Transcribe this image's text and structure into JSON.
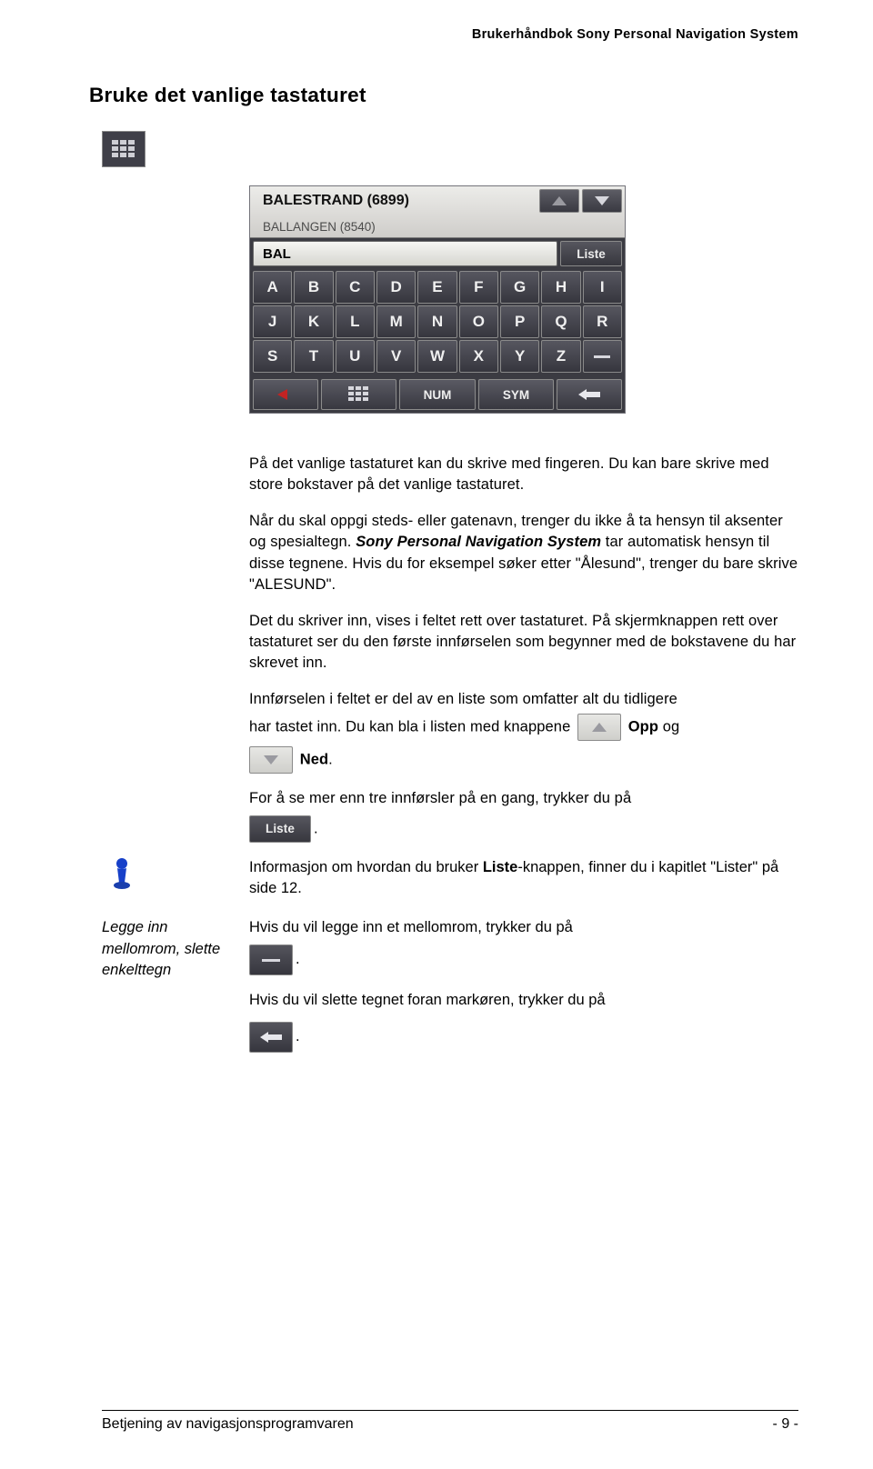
{
  "running_header": "Brukerhåndbok Sony Personal Navigation System",
  "section_title": "Bruke det vanlige tastaturet",
  "screenshot": {
    "suggestion_primary": "BALESTRAND (6899)",
    "suggestion_secondary": "BALLANGEN (8540)",
    "input_value": "BAL",
    "liste_label": "Liste",
    "row1": [
      "A",
      "B",
      "C",
      "D",
      "E",
      "F",
      "G",
      "H",
      "I"
    ],
    "row2": [
      "J",
      "K",
      "L",
      "M",
      "N",
      "O",
      "P",
      "Q",
      "R"
    ],
    "row3": [
      "S",
      "T",
      "U",
      "V",
      "W",
      "X",
      "Y",
      "Z",
      "_"
    ],
    "num_label": "NUM",
    "sym_label": "SYM"
  },
  "para1_a": "På det vanlige tastaturet kan du skrive med fingeren. Du kan bare skrive med store bokstaver på det vanlige tastaturet.",
  "para2_plain1": "Når du skal oppgi steds- eller gatenavn, trenger du ikke å ta hensyn til aksenter og spesialtegn. ",
  "para2_bi": "Sony Personal Navigation System",
  "para2_plain2": " tar automatisk hensyn til disse tegnene. Hvis du for eksempel søker etter \"Ålesund\", trenger du bare skrive \"ALESUND\".",
  "para3": "Det du skriver inn, vises i feltet rett over tastaturet. På skjermknappen rett over tastaturet ser du den første innførselen som begynner med de bokstavene du har skrevet inn.",
  "para4": "Innførselen i feltet er del av en liste som omfatter alt du tidligere",
  "para5_a": "har tastet inn. Du kan bla i listen med knappene ",
  "para5_opp": "Opp",
  "para5_og": " og",
  "para6_ned": "Ned",
  "para6_period": ".",
  "para7": "For å se mer enn tre innførsler på en gang, trykker du på",
  "inline_liste_dot": ".",
  "note_a": "Informasjon om hvordan du bruker ",
  "note_liste": "Liste",
  "note_b": "-knappen, finner du i kapitlet \"Lister\" på side 12.",
  "margin_label": "Legge inn mellomrom, slette enkelttegn",
  "space_line": "Hvis du vil legge inn et mellomrom, trykker du på",
  "space_dot": ".",
  "del_line": "Hvis du vil slette tegnet foran markøren, trykker du på",
  "del_dot": ".",
  "footer_left": "Betjening av navigasjonsprogramvaren",
  "footer_right": "- 9 -"
}
